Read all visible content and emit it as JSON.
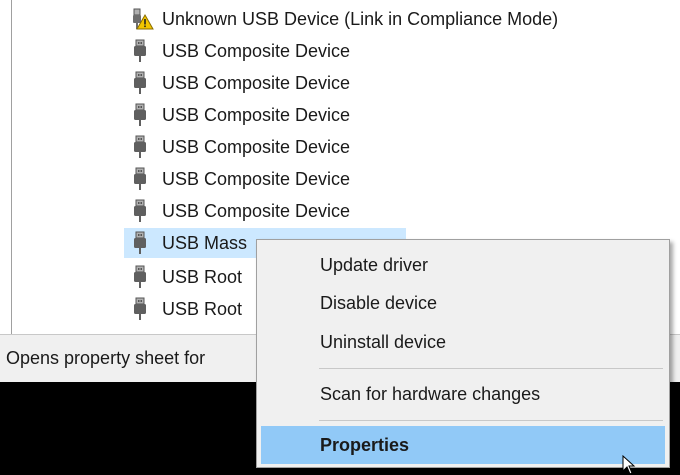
{
  "device_tree": {
    "items": [
      {
        "label": "Unknown USB Device (Link in Compliance Mode)",
        "icon": "usb-warning-icon",
        "selected": false
      },
      {
        "label": "USB Composite Device",
        "icon": "usb-plug-icon",
        "selected": false
      },
      {
        "label": "USB Composite Device",
        "icon": "usb-plug-icon",
        "selected": false
      },
      {
        "label": "USB Composite Device",
        "icon": "usb-plug-icon",
        "selected": false
      },
      {
        "label": "USB Composite Device",
        "icon": "usb-plug-icon",
        "selected": false
      },
      {
        "label": "USB Composite Device",
        "icon": "usb-plug-icon",
        "selected": false
      },
      {
        "label": "USB Composite Device",
        "icon": "usb-plug-icon",
        "selected": false
      },
      {
        "label": "USB Mass",
        "icon": "usb-plug-icon",
        "selected": true
      },
      {
        "label": "USB Root",
        "icon": "usb-plug-icon",
        "selected": false
      },
      {
        "label": "USB Root",
        "icon": "usb-plug-icon",
        "selected": false
      }
    ]
  },
  "status_bar": {
    "text": "Opens property sheet for"
  },
  "context_menu": {
    "items": [
      {
        "label": "Update driver",
        "highlighted": false
      },
      {
        "label": "Disable device",
        "highlighted": false
      },
      {
        "label": "Uninstall device",
        "highlighted": false
      },
      {
        "label": "Scan for hardware changes",
        "highlighted": false
      },
      {
        "label": "Properties",
        "highlighted": true
      }
    ]
  },
  "colors": {
    "selection": "#cce8ff",
    "menu_highlight": "#91c9f7",
    "warning": "#f2c500"
  }
}
